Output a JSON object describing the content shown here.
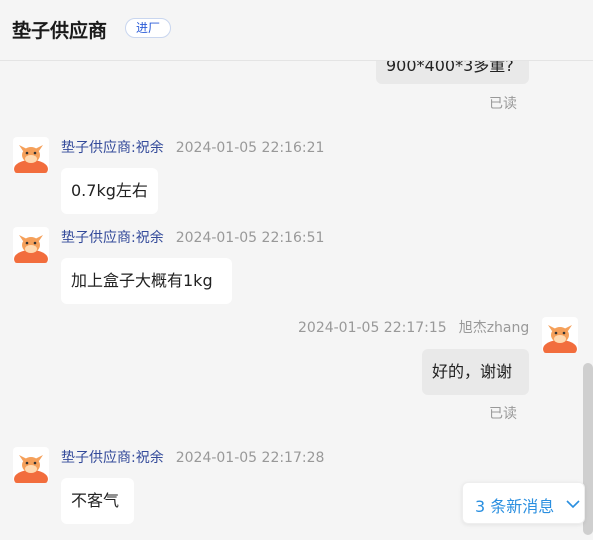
{
  "header": {
    "title": "垫子供应商",
    "badge": "进厂"
  },
  "messages": [
    {
      "direction": "out",
      "text": "900*400*3多重?",
      "read_label": "已读"
    },
    {
      "direction": "in",
      "sender": "垫子供应商:祝余",
      "time": "2024-01-05 22:16:21",
      "text": "0.7kg左右"
    },
    {
      "direction": "in",
      "sender": "垫子供应商:祝余",
      "time": "2024-01-05 22:16:51",
      "text": "加上盒子大概有1kg"
    },
    {
      "direction": "out",
      "sender": "旭杰zhang",
      "time": "2024-01-05 22:17:15",
      "text": "好的，谢谢",
      "read_label": "已读"
    },
    {
      "direction": "in",
      "sender": "垫子供应商:祝余",
      "time": "2024-01-05 22:17:28",
      "text": "不客气"
    }
  ],
  "new_messages": {
    "label": "3 条新消息",
    "icon": "chevron-down-icon"
  },
  "colors": {
    "accent": "#2a8fe0",
    "sender_name": "#334a9a",
    "avatar_face": "#f5a05a",
    "avatar_bg": "#f26d3d"
  }
}
